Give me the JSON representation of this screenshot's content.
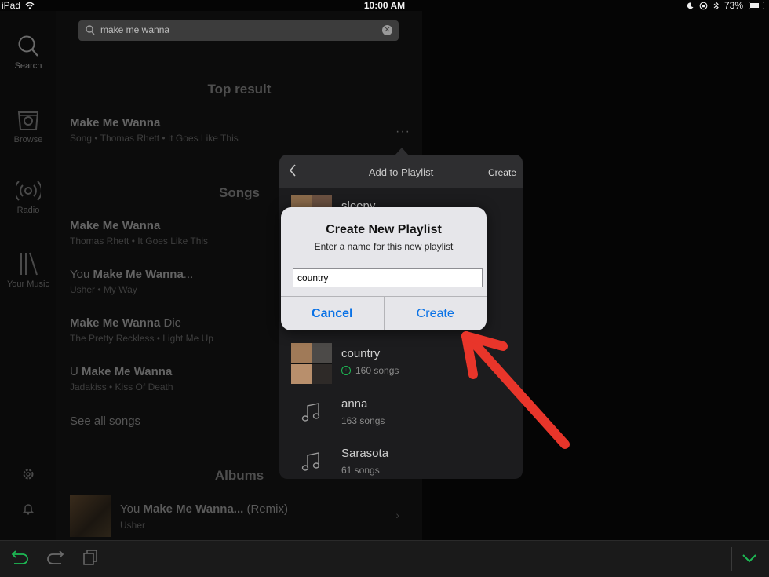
{
  "status_bar": {
    "device": "iPad",
    "time": "10:00 AM",
    "battery": "73%"
  },
  "sidebar": {
    "items": [
      {
        "label": "Search",
        "icon": "search-icon"
      },
      {
        "label": "Browse",
        "icon": "browse-icon"
      },
      {
        "label": "Radio",
        "icon": "radio-icon"
      },
      {
        "label": "Your Music",
        "icon": "library-icon"
      }
    ]
  },
  "search": {
    "query": "make me wanna"
  },
  "results": {
    "top_result_title": "Top result",
    "top_result": {
      "title": "Make Me Wanna",
      "subtitle": "Song • Thomas Rhett • It Goes Like This",
      "more": "···"
    },
    "songs_title": "Songs",
    "songs": [
      {
        "pre": "",
        "bold": "Make Me Wanna",
        "post": "",
        "subtitle": "Thomas Rhett • It Goes Like This"
      },
      {
        "pre": "You ",
        "bold": "Make Me Wanna",
        "post": "...",
        "subtitle": "Usher • My Way"
      },
      {
        "pre": "",
        "bold": "Make Me Wanna",
        "post": " Die",
        "subtitle": "The Pretty Reckless • Light Me Up"
      },
      {
        "pre": "U ",
        "bold": "Make Me Wanna",
        "post": "",
        "subtitle": "Jadakiss • Kiss Of Death"
      }
    ],
    "see_all": "See all songs",
    "albums_title": "Albums",
    "album": {
      "pre": "You ",
      "bold": "Make Me Wanna...",
      "post": " (Remix)",
      "subtitle": "Usher"
    }
  },
  "popover": {
    "title": "Add to Playlist",
    "create_label": "Create",
    "playlists": [
      {
        "name": "sleepy",
        "count": ""
      },
      {
        "name": "country",
        "count": "160 songs",
        "downloaded": true
      },
      {
        "name": "anna",
        "count": "163 songs"
      },
      {
        "name": "Sarasota",
        "count": "61 songs"
      }
    ]
  },
  "alert": {
    "title": "Create New Playlist",
    "message": "Enter a name for this new playlist",
    "input_value": "country",
    "cancel_label": "Cancel",
    "create_label": "Create"
  },
  "colors": {
    "accent_green": "#1db954",
    "ios_blue": "#0a72e6",
    "annotation_red": "#e8352a"
  }
}
